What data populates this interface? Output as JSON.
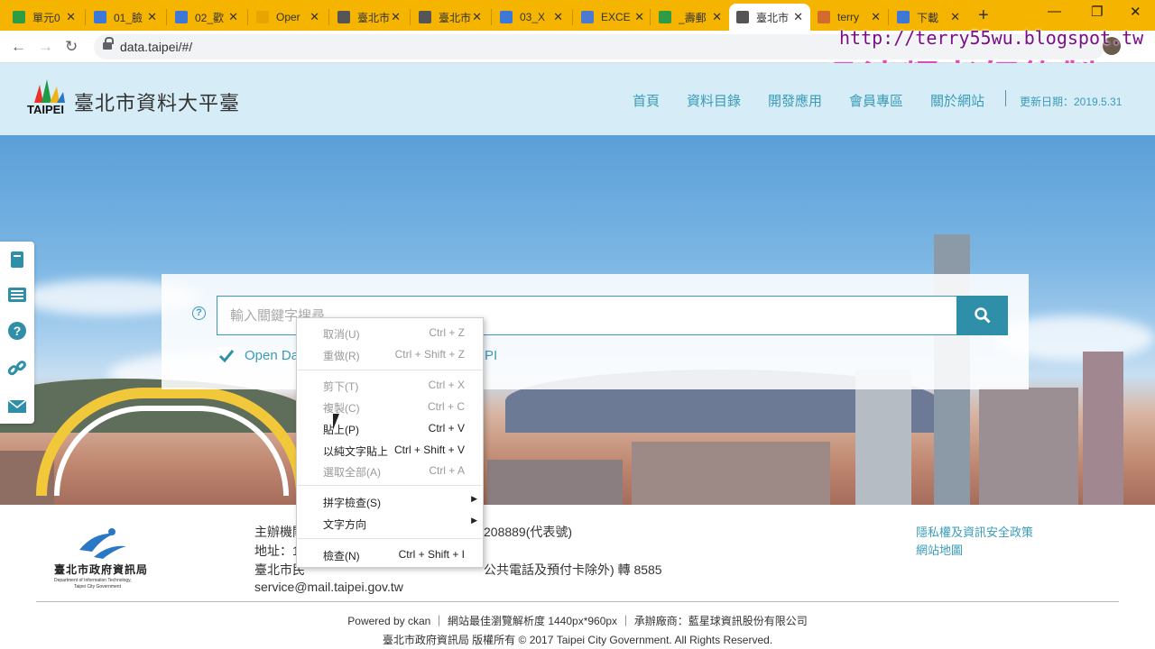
{
  "browser": {
    "tabs": [
      {
        "label": "單元0",
        "icon_color": "#2e9c45"
      },
      {
        "label": "01_臉",
        "icon_color": "#3d78d8"
      },
      {
        "label": "02_歡",
        "icon_color": "#3d78d8"
      },
      {
        "label": "Oper",
        "icon_color": "#e7a500"
      },
      {
        "label": "臺北市",
        "icon_color": "#555555"
      },
      {
        "label": "臺北市",
        "icon_color": "#555555"
      },
      {
        "label": "03_X",
        "icon_color": "#3d78d8"
      },
      {
        "label": "EXCE",
        "icon_color": "#4a7bd1"
      },
      {
        "label": "_壽郵",
        "icon_color": "#2e9c45"
      },
      {
        "label": "臺北市",
        "icon_color": "#555555"
      },
      {
        "label": "terry",
        "icon_color": "#d36b2f"
      },
      {
        "label": "下載",
        "icon_color": "#3d78d8"
      }
    ],
    "active_tab_index": 9,
    "url": "data.taipei/#/"
  },
  "watermark": {
    "url": "http://terry55wu.blogspot.tw",
    "name": "吳清輝老師錄製"
  },
  "site": {
    "logo_text": "TAIPEI",
    "title": "臺北市資料大平臺",
    "nav": [
      "首頁",
      "資料目錄",
      "開發應用",
      "會員專區",
      "關於網站"
    ],
    "update": "更新日期：2019.5.31"
  },
  "search": {
    "help": "?",
    "placeholder": "輸入關鍵字搜尋",
    "checkbox_label_left": "Open Da",
    "checkbox_label_right": "PI"
  },
  "context_menu": {
    "items": [
      {
        "label": "取消(U)",
        "shortcut": "Ctrl + Z",
        "enabled": false
      },
      {
        "label": "重做(R)",
        "shortcut": "Ctrl + Shift + Z",
        "enabled": false
      },
      {
        "label": "剪下(T)",
        "shortcut": "Ctrl + X",
        "enabled": false
      },
      {
        "label": "複製(C)",
        "shortcut": "Ctrl + C",
        "enabled": false
      },
      {
        "label": "貼上(P)",
        "shortcut": "Ctrl + V",
        "enabled": true
      },
      {
        "label": "以純文字貼上",
        "shortcut": "Ctrl + Shift + V",
        "enabled": true
      },
      {
        "label": "選取全部(A)",
        "shortcut": "Ctrl + A",
        "enabled": false
      },
      {
        "label": "拼字檢查(S)",
        "shortcut": "",
        "enabled": true,
        "submenu": true
      },
      {
        "label": "文字方向",
        "shortcut": "",
        "enabled": true,
        "submenu": true
      },
      {
        "label": "檢查(N)",
        "shortcut": "Ctrl + Shift + I",
        "enabled": true
      }
    ]
  },
  "footer": {
    "logo_title": "臺北市政府資訊局",
    "logo_en1": "Department of Information Technology,",
    "logo_en2": "Taipei City Government",
    "line1_a": "主辦機關",
    "line1_b": "208889(代表號)",
    "line2": "地址：1",
    "line3_a": "臺北市民",
    "line3_b": "公共電話及預付卡除外) 轉 8585",
    "line4": "service@mail.taipei.gov.tw",
    "link_privacy": "隱私權及資訊安全政策",
    "link_sitemap": "網站地圖",
    "powered": "Powered by ckan  ｜  網站最佳瀏覽解析度 1440px*960px  ｜  承辦廠商：藍星球資訊股份有限公司",
    "copyright": "臺北市政府資訊局 版權所有 © 2017 Taipei City Government. All Rights Reserved."
  }
}
